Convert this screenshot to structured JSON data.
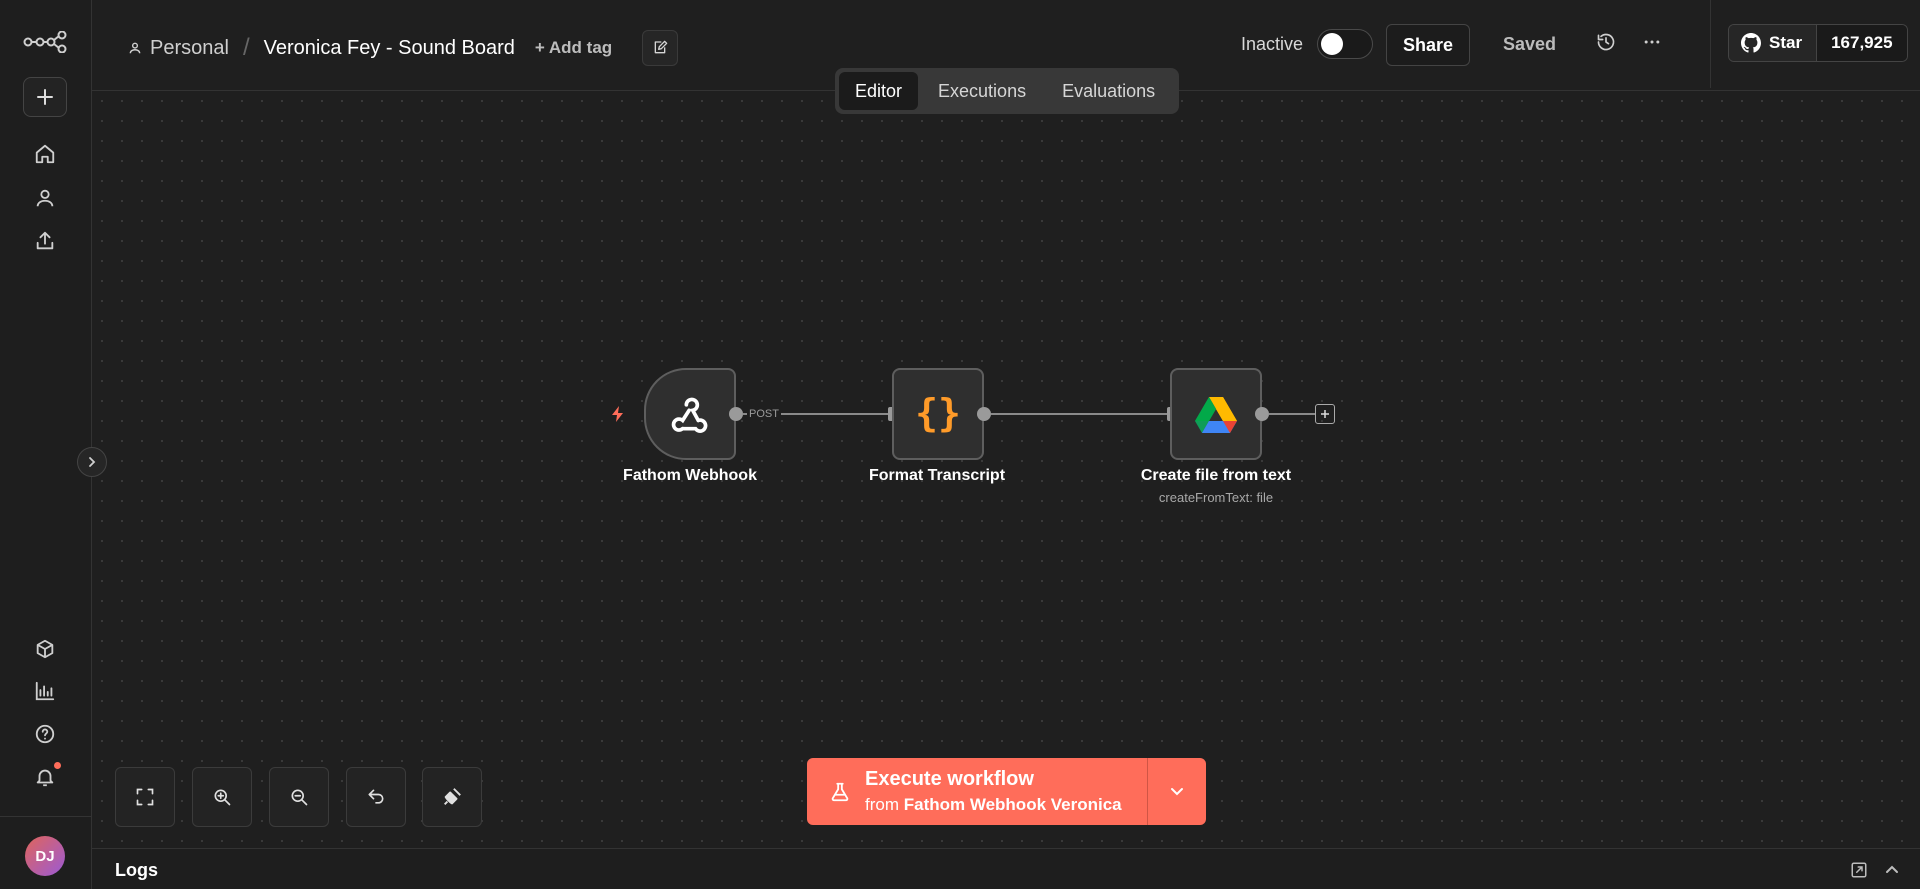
{
  "header": {
    "project": "Personal",
    "workflow_title": "Veronica Fey - Sound Board",
    "add_tag": "+ Add tag",
    "status_label": "Inactive",
    "share_label": "Share",
    "saved_label": "Saved",
    "github_star_label": "Star",
    "github_star_count": "167,925"
  },
  "tabs": [
    {
      "label": "Editor",
      "active": true
    },
    {
      "label": "Executions",
      "active": false
    },
    {
      "label": "Evaluations",
      "active": false
    }
  ],
  "nodes": [
    {
      "name": "Fathom Webhook",
      "subtitle": "",
      "icon": "webhook-icon"
    },
    {
      "name": "Format Transcript",
      "subtitle": "",
      "icon": "code-braces-icon"
    },
    {
      "name": "Create file from text",
      "subtitle": "createFromText: file",
      "icon": "google-drive-icon"
    }
  ],
  "edges": [
    {
      "from": "Fathom Webhook",
      "to": "Format Transcript",
      "label": "POST"
    },
    {
      "from": "Format Transcript",
      "to": "Create file from text",
      "label": ""
    }
  ],
  "execute": {
    "title": "Execute workflow",
    "from_prefix": "from",
    "from_node": "Fathom Webhook Veronica"
  },
  "logs": {
    "label": "Logs"
  },
  "user": {
    "initials": "DJ"
  },
  "colors": {
    "accent": "#ff6d5a",
    "background": "#1f1f1f",
    "node_border": "#5e5e5e"
  }
}
